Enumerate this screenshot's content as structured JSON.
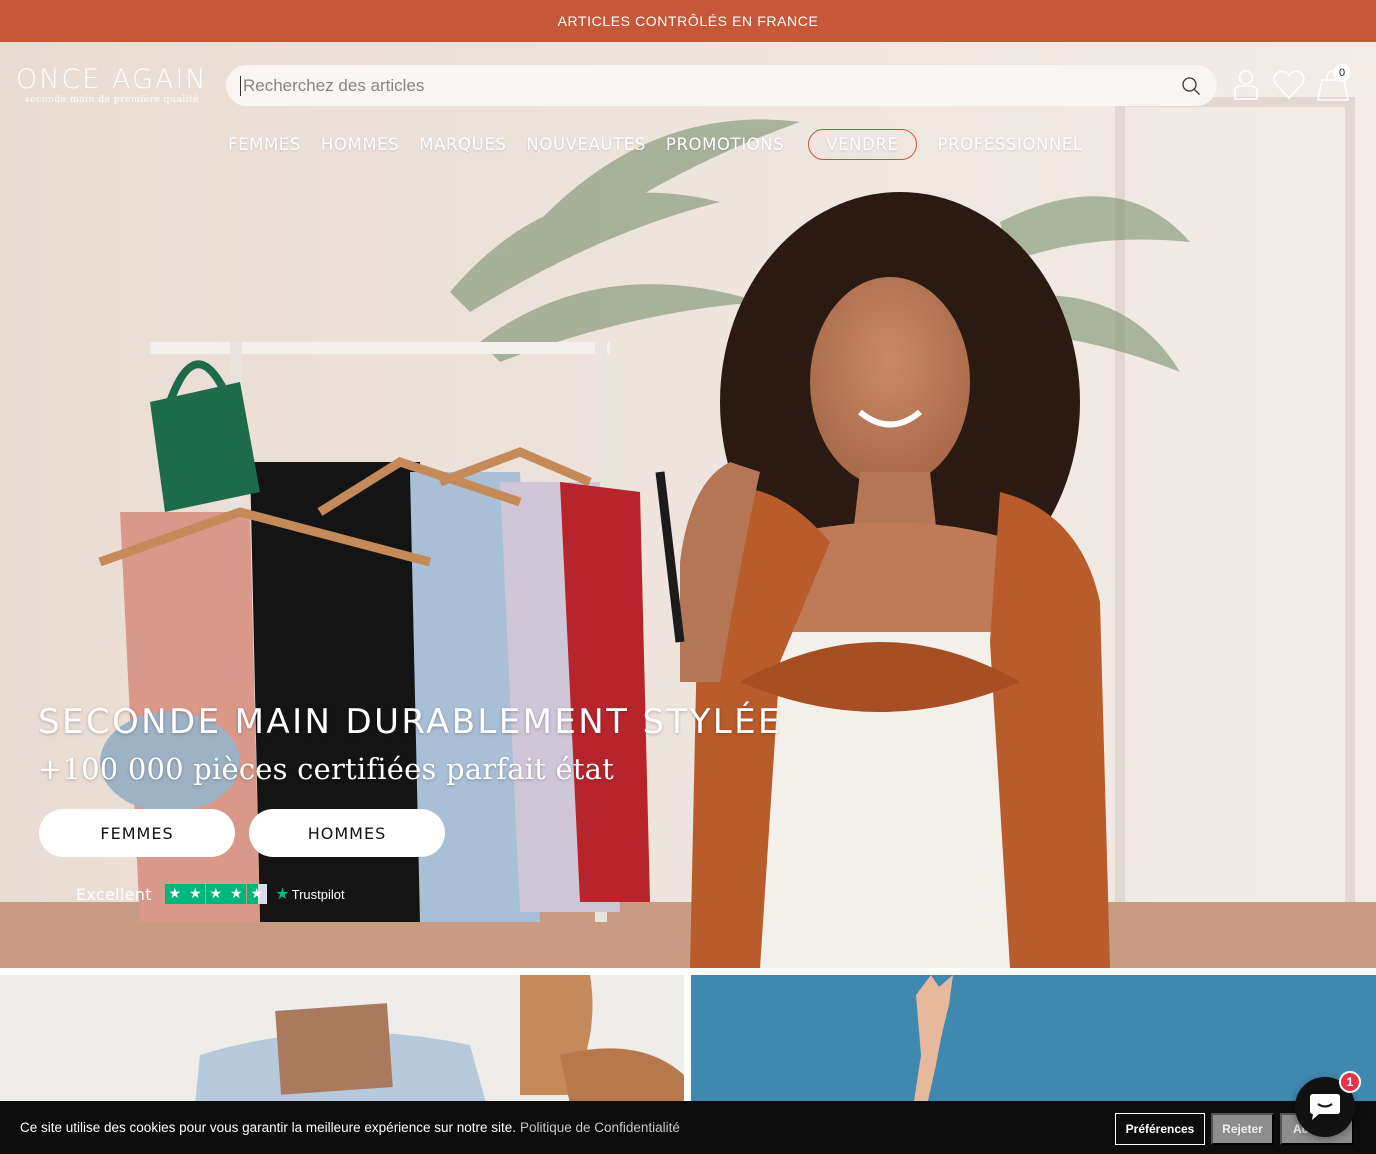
{
  "announcement": "ARTICLES CONTRÔLÉS EN FRANCE",
  "logo": {
    "name": "ONCE AGAIN",
    "tagline": "seconde main de première qualité"
  },
  "search": {
    "placeholder": "Recherchez des articles"
  },
  "header_icons": [
    "account-icon",
    "heart-icon",
    "bag-icon"
  ],
  "cart": {
    "count": "0"
  },
  "nav": {
    "items": [
      {
        "label": "FEMMES"
      },
      {
        "label": "HOMMES"
      },
      {
        "label": "MARQUES"
      },
      {
        "label": "NOUVEAUTES"
      },
      {
        "label": "PROMOTIONS"
      },
      {
        "label": "VENDRE"
      },
      {
        "label": "PROFESSIONNEL"
      }
    ]
  },
  "hero": {
    "title": "SECONDE MAIN DURABLEMENT STYLÉE",
    "subtitle": "+100 000 pièces certifiées parfait état",
    "cta_women": "FEMMES",
    "cta_men": "HOMMES"
  },
  "trustpilot": {
    "rating_label": "Excellent",
    "stars": 4.5,
    "brand": "Trustpilot"
  },
  "cookie": {
    "text": "Ce site utilise des cookies pour vous garantir la meilleure expérience sur notre site.",
    "link": "Politique de Confidentialité",
    "preferences": "Préférences",
    "reject": "Rejeter",
    "accept": "Ac"
  },
  "chat": {
    "unread": "1"
  },
  "colors": {
    "brand": "#c65839",
    "trustpilot": "#00b67a",
    "badge": "#e1344a"
  }
}
